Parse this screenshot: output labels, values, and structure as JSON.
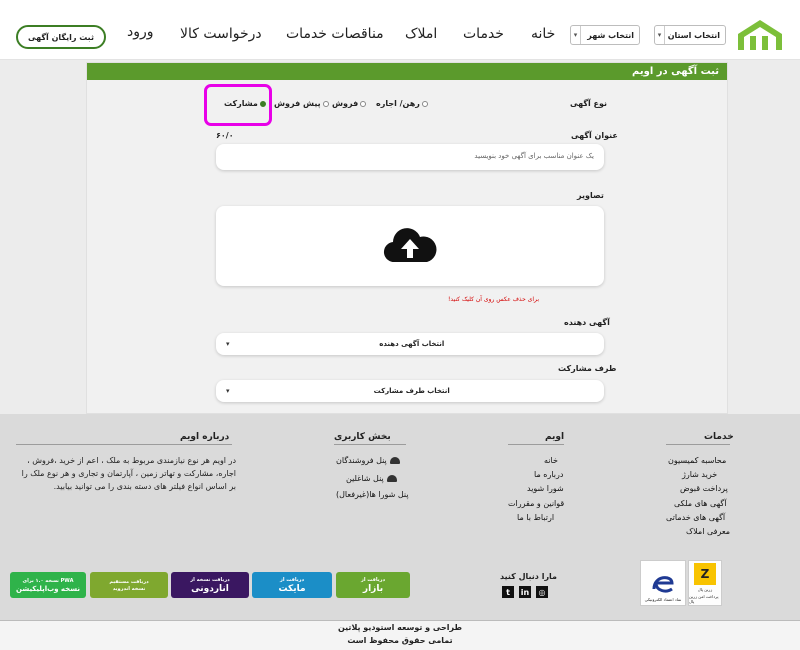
{
  "header": {
    "province_select": "انتخاب استان",
    "city_select": "انتخاب شهر",
    "nav": [
      "خانه",
      "خدمات",
      "املاک",
      "مناقصات خدمات",
      "درخواست کالا",
      "ورود"
    ],
    "register_button": "ثبت رایگان آگهی"
  },
  "form": {
    "heading": "ثبت آگهی در اویم",
    "ad_type_label": "نوع آگهی",
    "ad_types": [
      "رهن/ اجاره",
      "فروش",
      "پیش فروش",
      "مشارکت"
    ],
    "selected_type": "مشارکت",
    "title_label": "عنوان آگهی",
    "title_counter": "۶۰/۰",
    "title_placeholder": "یک عنوان مناسب برای آگهی خود بنویسید",
    "images_label": "تصاویر",
    "delete_note": "برای حذف عکس روی آن کلیک کنید!",
    "advertiser_label": "آگهی دهنده",
    "advertiser_select": "انتخاب آگهی دهنده",
    "partner_label": "طرف مشارکت",
    "partner_select": "انتخاب طرف مشارکت"
  },
  "footer": {
    "services": {
      "title": "خدمات",
      "links": [
        "محاسبه کمیسیون",
        "خرید شارژ",
        "پرداخت قبوض",
        "آگهی های ملکی",
        "آگهی های خدماتی",
        "معرفی املاک"
      ]
    },
    "owim": {
      "title": "اویم",
      "links": [
        "خانه",
        "درباره ما",
        "شورا شوید",
        "قوانین و مقررات",
        "ارتباط با ما"
      ]
    },
    "users": {
      "title": "بخش کاربری",
      "links": [
        "پنل فروشندگان",
        "پنل شاغلین",
        "پنل شورا ها(غیرفعال)"
      ]
    },
    "about": {
      "title": "درباره اویم",
      "text": "در اویم هر نوع نیازمندی مربوط به ملک ، اعم از خرید ،فروش ، اجاره، مشارکت و تهاتر زمین ، آپارتمان و تجاری و هر نوع ملک را بر اساس انواع فیلتر های دسته بندی را می توانید بیابید."
    },
    "follow_label": "مارا دنبال کنید",
    "social": [
      "in",
      "in",
      "◎"
    ],
    "badges": {
      "pwa": "نسخه وب‌اپلیکیشن",
      "pwa_sub": "نسخه ۱.۰ برای PWA",
      "direct_title": "دریافت مستقیم",
      "direct_sub": "نسخه اندروید",
      "anardoni": "اناردونی",
      "anardoni_sub": "دریافت نسخه از",
      "myket": "مایکت",
      "myket_sub": "دریافت از",
      "bazaar": "بازار",
      "bazaar_sub": "دریافت از"
    },
    "trust": {
      "enamad": "نماد اعتماد الکترونیکی",
      "zarinpal": "زرین پال",
      "zarinpal_note": "پرداخت امن زرین پال"
    },
    "credits": "طراحی و توسعه استودیو پلاتین",
    "rights": "تمامی حقوق محفوظ است"
  },
  "colors": {
    "brand_green": "#5b9a2c",
    "highlight": "#e800e8"
  }
}
